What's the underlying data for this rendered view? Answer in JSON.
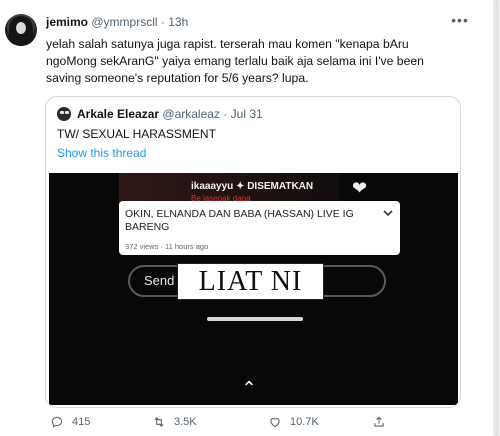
{
  "tweet": {
    "author_name": "jemimo",
    "author_handle": "@ymmprscll",
    "separator": "·",
    "time": "13h",
    "more_icon": "more-dots-icon",
    "text": "yelah salah satunya juga rapist. terserah mau komen \"kenapa bAru\nngoMong sekAranG\" yaiya emang terlalu baik aja selama ini I've been\nsaving someone's reputation for 5/6 years? lupa."
  },
  "quoted": {
    "author_name": "Arkale Eleazar",
    "author_handle": "@arkaleaz",
    "separator": "·",
    "date": "Jul 31",
    "text": "TW/ SEXUAL HARASSMENT",
    "show_thread": "Show this thread",
    "media": {
      "pinned_user": "ikaaayyu",
      "pinned_label": "✦ DISEMATKAN",
      "pinned_sub": "Be jasepak dapa",
      "card_title": "OKIN, ELNANDA DAN BABA (HASSAN) LIVE IG BARENG",
      "card_meta": "372 views · 11 hours ago",
      "send_text": "Send M",
      "overlay_text": "LIAT NI",
      "caret": "⌃"
    }
  },
  "actions": {
    "reply_count": "415",
    "retweet_count": "3.5K",
    "like_count": "10.7K"
  },
  "colors": {
    "accent": "#1d9bf0",
    "secondary_text": "#536471",
    "border": "#cfd9de"
  }
}
